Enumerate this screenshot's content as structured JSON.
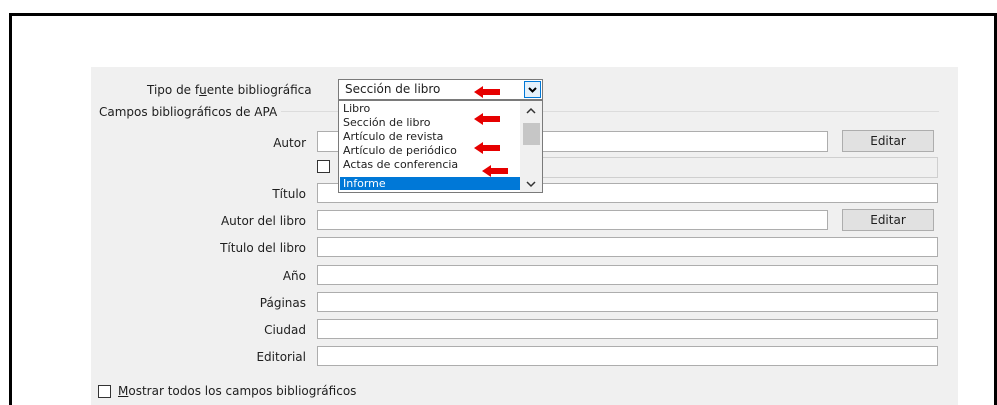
{
  "source_type": {
    "label_before": "Tipo de f",
    "label_mnemonic": "u",
    "label_after": "ente bibliográfica",
    "selected": "Sección de libro",
    "options": [
      "Libro",
      "Sección de libro",
      "Artículo de revista",
      "Artículo de periódico",
      "Actas de conferencia",
      "Informe"
    ],
    "highlighted_option": "Informe"
  },
  "group_label": "Campos bibliográficos de APA",
  "fields": {
    "author_label": "Autor",
    "title_label": "Título",
    "book_author_label": "Autor del libro",
    "book_title_label": "Título del libro",
    "year_label": "Año",
    "pages_label": "Páginas",
    "city_label": "Ciudad",
    "publisher_label": "Editorial"
  },
  "buttons": {
    "edit_author": "Editar",
    "edit_book_author": "Editar"
  },
  "show_all": {
    "mnemonic": "M",
    "rest": "ostrar todos los campos bibliográficos"
  },
  "colors": {
    "arrow": "#e60000",
    "highlight": "#0078d7",
    "dialog_bg": "#f0f0f0"
  },
  "icons": {
    "dropdown": "chevron-down-icon",
    "scroll_up": "chevron-up-icon",
    "scroll_down": "chevron-down-icon",
    "annotation": "left-arrow-icon"
  }
}
